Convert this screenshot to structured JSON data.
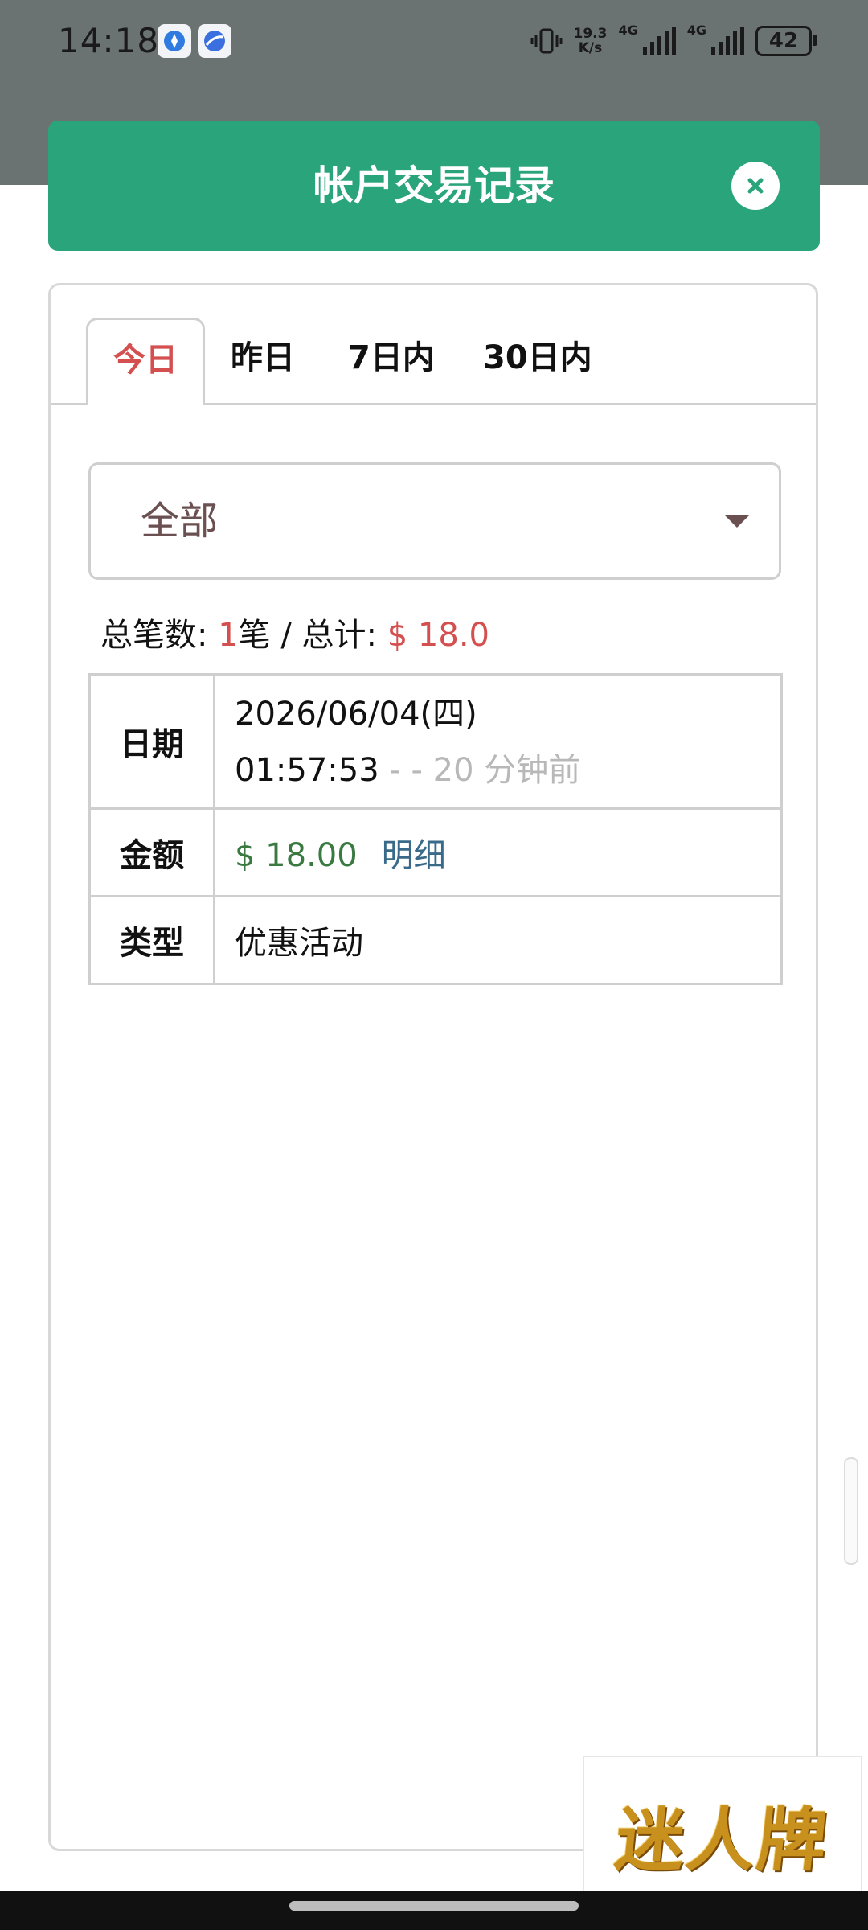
{
  "status_bar": {
    "time": "14:18",
    "app_icons": [
      "blue-compass-icon",
      "blue-planet-icon"
    ],
    "speed_value": "19.3",
    "speed_unit": "K/s",
    "network_1": "4G",
    "network_2": "4G",
    "battery": "42"
  },
  "header": {
    "title": "帐户交易记录",
    "close_icon": "close-icon",
    "color": "#2aa47a"
  },
  "tabs": [
    {
      "label": "今日",
      "active": true
    },
    {
      "label": "昨日",
      "active": false
    },
    {
      "label": "7日内",
      "active": false
    },
    {
      "label": "30日内",
      "active": false
    }
  ],
  "filter": {
    "selected": "全部"
  },
  "summary": {
    "count_label": "总笔数: ",
    "count": "1",
    "count_unit": "笔 / 总计: ",
    "total": "$ 18.0"
  },
  "record": {
    "date_label": "日期",
    "date": "2026/06/04(四)",
    "time": "01:57:53",
    "relative": " - - 20 分钟前",
    "amount_label": "金额",
    "amount": "$ 18.00",
    "detail_link": "明细",
    "type_label": "类型",
    "type": "优惠活动"
  },
  "watermark": {
    "text": "迷人牌"
  },
  "colors": {
    "accent_red": "#d45050",
    "amount_green": "#3a7a40",
    "link_blue": "#3a6a8a"
  }
}
